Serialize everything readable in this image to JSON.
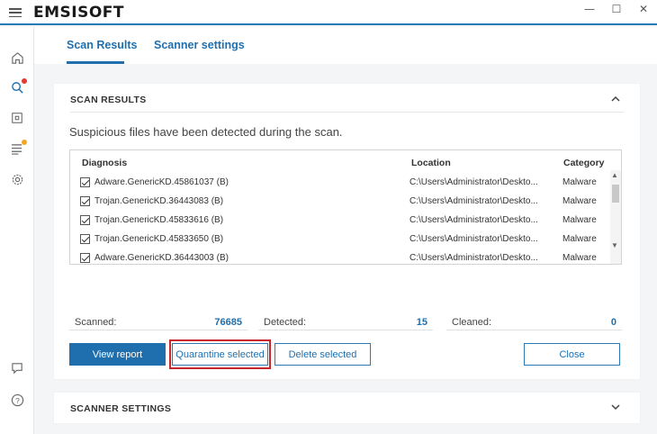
{
  "app": {
    "logo": "EMSISOFT"
  },
  "window_controls": {
    "minimize": "—",
    "maximize": "☐",
    "close": "✕"
  },
  "sidebar": {
    "icons": [
      "home-icon",
      "scan-icon",
      "quarantine-icon",
      "logs-icon",
      "settings-icon",
      "chat-icon",
      "help-icon"
    ],
    "notification_color": "#e53935",
    "warning_color": "#f5a623"
  },
  "tabs": [
    {
      "label": "Scan Results",
      "active": true
    },
    {
      "label": "Scanner settings",
      "active": false
    }
  ],
  "scan_results": {
    "title": "SCAN RESULTS",
    "subtitle": "Suspicious files have been detected during the scan.",
    "columns": [
      "Diagnosis",
      "Location",
      "Category"
    ],
    "rows": [
      {
        "checked": true,
        "diagnosis": "Adware.GenericKD.45861037 (B)",
        "location": "C:\\Users\\Administrator\\Deskto...",
        "category": "Malware"
      },
      {
        "checked": true,
        "diagnosis": "Trojan.GenericKD.36443083 (B)",
        "location": "C:\\Users\\Administrator\\Deskto...",
        "category": "Malware"
      },
      {
        "checked": true,
        "diagnosis": "Trojan.GenericKD.45833616 (B)",
        "location": "C:\\Users\\Administrator\\Deskto...",
        "category": "Malware"
      },
      {
        "checked": true,
        "diagnosis": "Trojan.GenericKD.45833650 (B)",
        "location": "C:\\Users\\Administrator\\Deskto...",
        "category": "Malware"
      },
      {
        "checked": true,
        "diagnosis": "Adware.GenericKD.36443003 (B)",
        "location": "C:\\Users\\Administrator\\Deskto...",
        "category": "Malware"
      }
    ],
    "stats": {
      "scanned_label": "Scanned:",
      "scanned_value": "76685",
      "detected_label": "Detected:",
      "detected_value": "15",
      "cleaned_label": "Cleaned:",
      "cleaned_value": "0"
    },
    "buttons": {
      "view_report": "View report",
      "quarantine_selected": "Quarantine selected",
      "delete_selected": "Delete selected",
      "close": "Close"
    }
  },
  "scanner_settings": {
    "title": "SCANNER SETTINGS"
  },
  "colors": {
    "accent": "#1f6fae",
    "highlight": "#c8262c"
  }
}
